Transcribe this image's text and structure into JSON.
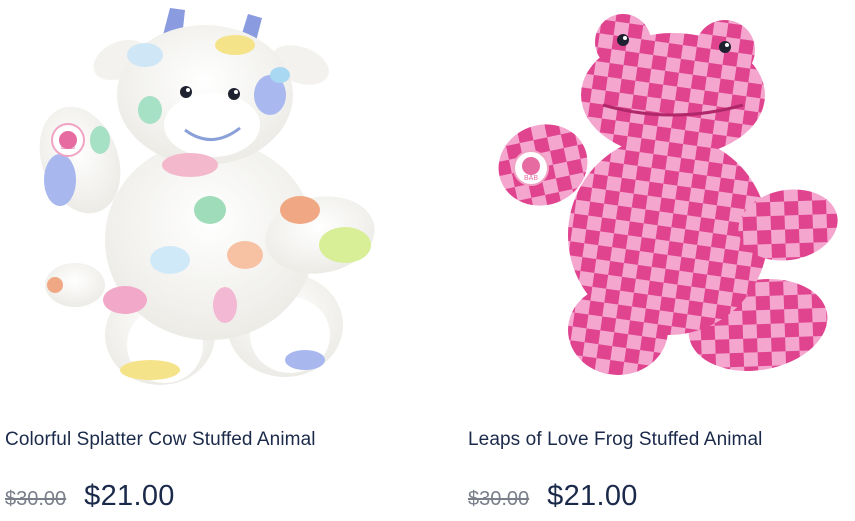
{
  "products": [
    {
      "name": "Colorful Splatter Cow Stuffed Animal",
      "original_price": "$30.00",
      "sale_price": "$21.00",
      "image_subject": "white plush cow with pastel paint splatters",
      "paw_badge": "BAB"
    },
    {
      "name": "Leaps of Love Frog Stuffed Animal",
      "original_price": "$30.00",
      "sale_price": "$21.00",
      "image_subject": "pink checkered plush frog",
      "paw_badge": "BAB"
    }
  ],
  "colors": {
    "text_primary": "#1b2a4a",
    "text_strikethrough": "#7a7f8a",
    "cow_fur": "#f7f6f2",
    "frog_pink_light": "#f4a6cf",
    "frog_pink_dark": "#e0448f"
  }
}
